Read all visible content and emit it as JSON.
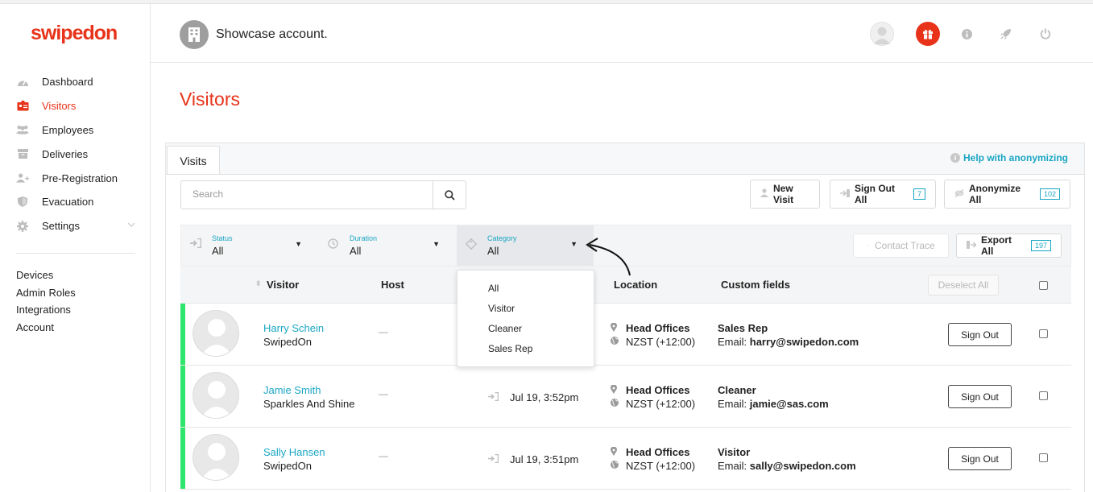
{
  "brand": {
    "logo": "swipedon",
    "accent": "#e8331a",
    "link_color": "#1aa6c4",
    "status_green": "#2ee66b"
  },
  "sidebar": {
    "items": [
      {
        "label": "Dashboard",
        "icon": "dashboard-icon"
      },
      {
        "label": "Visitors",
        "icon": "visitor-badge-icon",
        "active": true
      },
      {
        "label": "Employees",
        "icon": "employees-icon"
      },
      {
        "label": "Deliveries",
        "icon": "box-icon"
      },
      {
        "label": "Pre-Registration",
        "icon": "user-plus-icon"
      },
      {
        "label": "Evacuation",
        "icon": "shield-icon"
      },
      {
        "label": "Settings",
        "icon": "gear-icon"
      }
    ],
    "links": [
      "Devices",
      "Admin Roles",
      "Integrations",
      "Account"
    ]
  },
  "header": {
    "account_name": "Showcase account."
  },
  "page": {
    "title": "Visitors"
  },
  "tabs": {
    "visits": "Visits"
  },
  "help_link": "Help with anonymizing",
  "search": {
    "placeholder": "Search",
    "value": ""
  },
  "toolbar": {
    "new_visit": "New Visit",
    "sign_out_all": "Sign Out All",
    "sign_out_all_count": "7",
    "anonymize_all": "Anonymize All",
    "anonymize_all_count": "102",
    "contact_trace": "Contact Trace",
    "export_all": "Export All",
    "export_all_count": "197"
  },
  "filters": {
    "status": {
      "label": "Status",
      "value": "All"
    },
    "duration": {
      "label": "Duration",
      "value": "All"
    },
    "category": {
      "label": "Category",
      "value": "All"
    }
  },
  "category_options": [
    "All",
    "Visitor",
    "Cleaner",
    "Sales Rep"
  ],
  "table": {
    "headers": {
      "visitor": "Visitor",
      "host": "Host",
      "location": "Location",
      "custom_fields": "Custom fields"
    },
    "deselect_all": "Deselect All",
    "sign_out_label": "Sign Out",
    "rows": [
      {
        "name": "Harry Schein",
        "company": "SwipedOn",
        "host": "—",
        "signed_in": "",
        "location": "Head Offices",
        "timezone": "NZST (+12:00)",
        "category": "Sales Rep",
        "email_label": "Email:",
        "email": "harry@swipedon.com"
      },
      {
        "name": "Jamie Smith",
        "company": "Sparkles And Shine",
        "host": "—",
        "signed_in": "Jul 19, 3:52pm",
        "location": "Head Offices",
        "timezone": "NZST (+12:00)",
        "category": "Cleaner",
        "email_label": "Email:",
        "email": "jamie@sas.com"
      },
      {
        "name": "Sally Hansen",
        "company": "SwipedOn",
        "host": "—",
        "signed_in": "Jul 19, 3:51pm",
        "location": "Head Offices",
        "timezone": "NZST (+12:00)",
        "category": "Visitor",
        "email_label": "Email:",
        "email": "sally@swipedon.com"
      }
    ]
  }
}
